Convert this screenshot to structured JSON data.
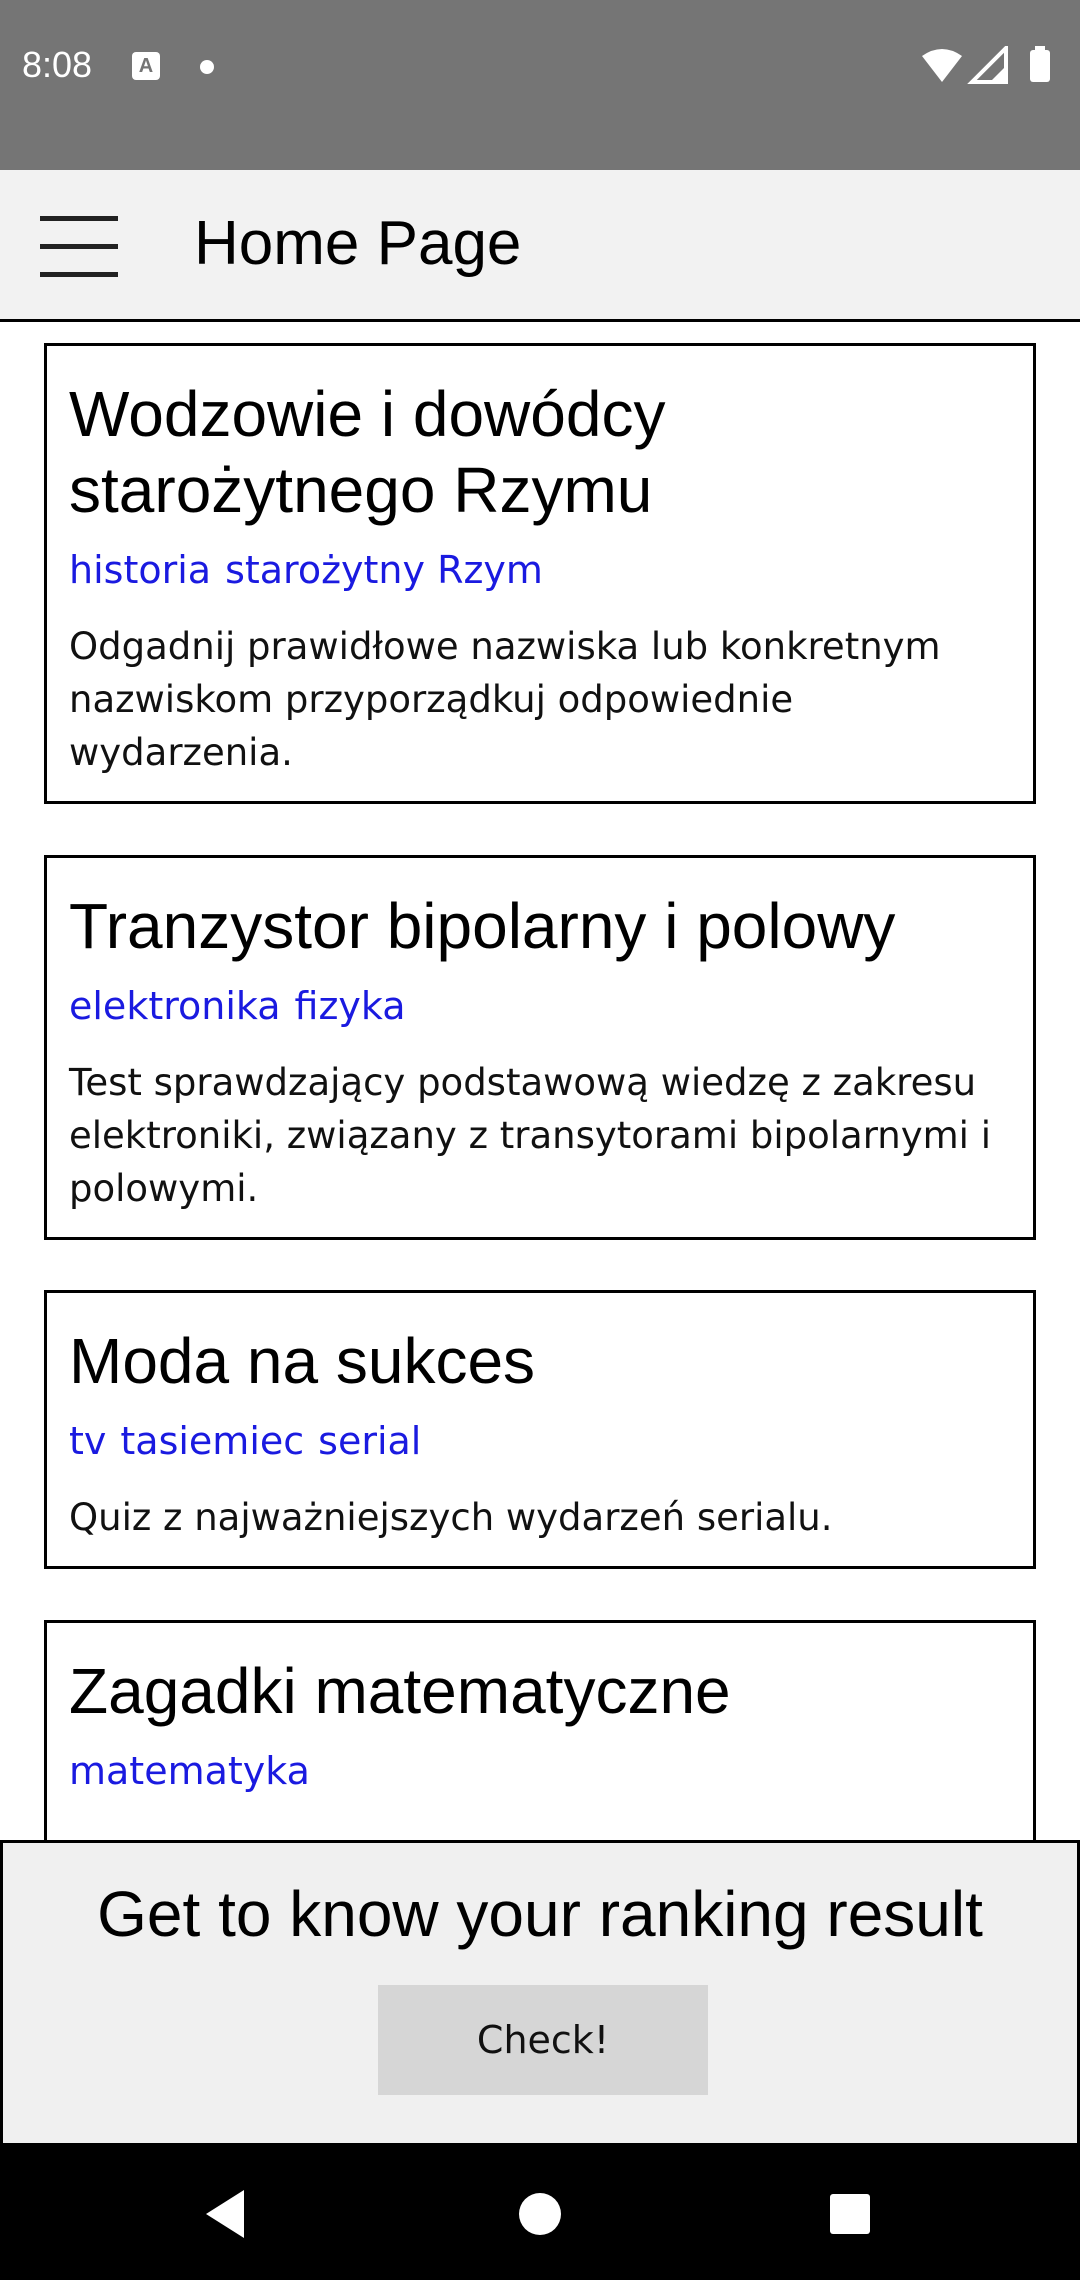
{
  "status_bar": {
    "time": "8:08",
    "notification_icon_letter": "A"
  },
  "app_bar": {
    "menu_icon": "hamburger-menu-icon",
    "title": "Home Page"
  },
  "quizzes": [
    {
      "title": "Wodzowie i dowódcy starożytnego Rzymu",
      "tags": [
        "historia",
        "starożytny Rzym"
      ],
      "description": "Odgadnij prawidłowe nazwiska lub konkretnym nazwiskom przyporządkuj odpowiednie wydarzenia."
    },
    {
      "title": "Tranzystor bipolarny i polowy",
      "tags": [
        "elektronika",
        "fizyka"
      ],
      "description": "Test sprawdzający podstawową wiedzę z zakresu elektroniki, związany z transytorami bipolarnymi i polowymi."
    },
    {
      "title": "Moda na sukces",
      "tags": [
        "tv",
        "tasiemiec",
        "serial"
      ],
      "description": "Quiz z najważniejszych wydarzeń serialu."
    },
    {
      "title": "Zagadki matematyczne",
      "tags": [
        "matematyka"
      ],
      "description": ""
    }
  ],
  "ranking": {
    "text": "Get to know your ranking result",
    "button_label": "Check!"
  },
  "colors": {
    "status_bar": "#757575",
    "app_bar": "#f2f2f2",
    "tag": "#1a1ae0",
    "button": "#d6d6d6"
  }
}
